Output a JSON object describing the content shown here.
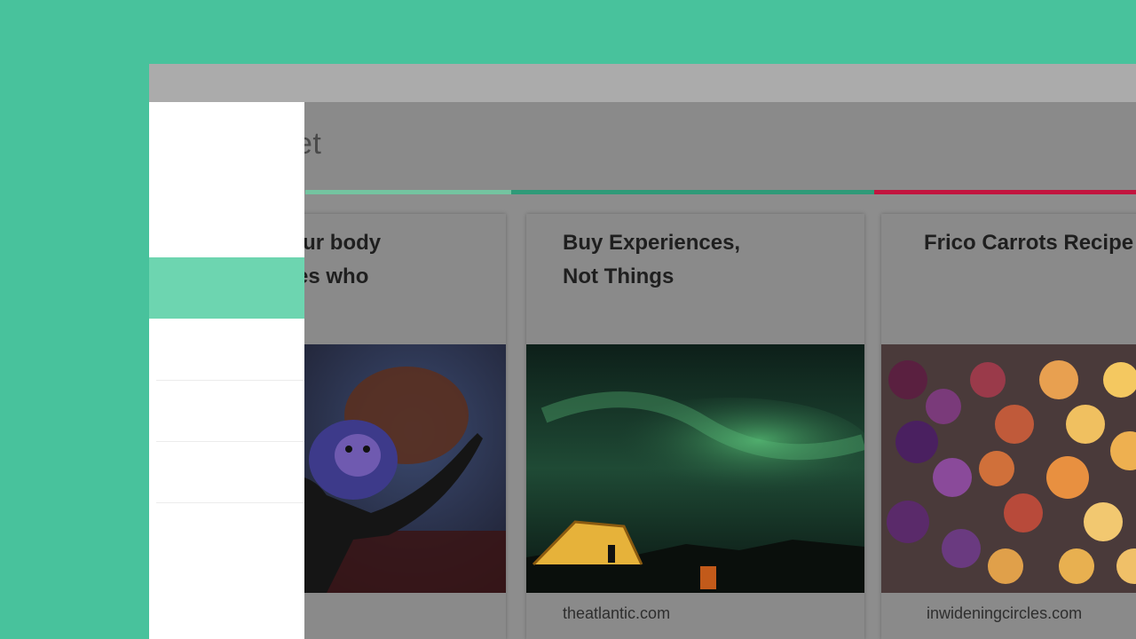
{
  "app": {
    "logo_fragment": "cket"
  },
  "progress": {
    "segments": [
      {
        "color": "#74c3a0"
      },
      {
        "color": "#2f9a78"
      },
      {
        "color": "#c2143f"
      }
    ]
  },
  "cards": [
    {
      "title": "ly: Your body\nshapes who",
      "thumbnail": "orangutan-speaker-photo",
      "source": ""
    },
    {
      "title": "Buy Experiences,\nNot Things",
      "thumbnail": "aurora-camp-photo",
      "source": "theatlantic.com"
    },
    {
      "title": "Frico Carrots Recipe",
      "thumbnail": "chopped-carrots-photo",
      "source": "inwideningcircles.com"
    }
  ],
  "sidebar": {
    "items": [
      {
        "name": "sidebar-item-1"
      },
      {
        "name": "sidebar-item-2"
      },
      {
        "name": "sidebar-item-3"
      },
      {
        "name": "sidebar-item-4"
      }
    ]
  }
}
